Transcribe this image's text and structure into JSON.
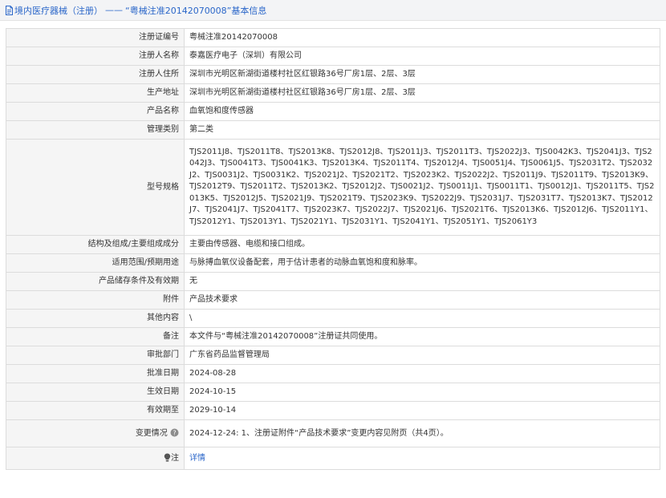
{
  "header": {
    "crumb": "境内医疗器械（注册）",
    "separator": "——",
    "record_title": "“粤械注准20142070008”基本信息"
  },
  "rows": [
    {
      "label": "注册证编号",
      "value": "粤械注准20142070008"
    },
    {
      "label": "注册人名称",
      "value": "泰嘉医疗电子（深圳）有限公司"
    },
    {
      "label": "注册人住所",
      "value": "深圳市光明区新湖街道楼村社区红银路36号厂房1层、2层、3层"
    },
    {
      "label": "生产地址",
      "value": "深圳市光明区新湖街道楼村社区红银路36号厂房1层、2层、3层"
    },
    {
      "label": "产品名称",
      "value": "血氧饱和度传感器"
    },
    {
      "label": "管理类别",
      "value": "第二类"
    },
    {
      "label": "型号规格",
      "value": "TJS2011J8、TJS2011T8、TJS2013K8、TJS2012J8、TJS2011J3、TJS2011T3、TJS2022J3、TJS0042K3、TJS2041J3、TJS2042J3、TJS0041T3、TJS0041K3、TJS2013K4、TJS2011T4、TJS2012J4、TJS0051J4、TJS0061J5、TJS2031T2、TJS2032J2、TJS0031J2、TJS0031K2、TJS2021J2、TJS2021T2、TJS2023K2、TJS2022J2、TJS2011J9、TJS2011T9、TJS2013K9、TJS2012T9、TJS2011T2、TJS2013K2、TJS2012J2、TJS0021J2、TJS0011J1、TJS0011T1、TJS0012J1、TJS2011T5、TJS2013K5、TJS2012J5、TJS2021J9、TJS2021T9、TJS2023K9、TJS2022J9、TJS2031J7、TJS2031T7、TJS2013K7、TJS2012J7、TJS2041J7、TJS2041T7、TJS2023K7、TJS2022J7、TJS2021J6、TJS2021T6、TJS2013K6、TJS2012J6、TJS2011Y1、TJS2012Y1、TJS2013Y1、TJS2021Y1、TJS2031Y1、TJS2041Y1、TJS2051Y1、TJS2061Y3"
    },
    {
      "label": "结构及组成/主要组成成分",
      "value": "主要由传感器、电缆和接口组成。"
    },
    {
      "label": "适用范围/预期用途",
      "value": "与脉搏血氧仪设备配套，用于估计患者的动脉血氧饱和度和脉率。"
    },
    {
      "label": "产品储存条件及有效期",
      "value": "无"
    },
    {
      "label": "附件",
      "value": "产品技术要求"
    },
    {
      "label": "其他内容",
      "value": "\\"
    },
    {
      "label": "备注",
      "value": "本文件与“粤械注准20142070008”注册证共同使用。"
    },
    {
      "label": "审批部门",
      "value": "广东省药品监督管理局"
    },
    {
      "label": "批准日期",
      "value": "2024-08-28"
    },
    {
      "label": "生效日期",
      "value": "2024-10-15"
    },
    {
      "label": "有效期至",
      "value": "2029-10-14"
    },
    {
      "label": "变更情况",
      "value": "2024-12-24: 1、注册证附件“产品技术要求”变更内容见附页（共4页）。"
    }
  ],
  "note_row": {
    "label": "注",
    "link": "详情"
  },
  "icons": {
    "title": "document-icon",
    "changes": "help-circle-icon",
    "note": "lightbulb-icon"
  },
  "colors": {
    "link": "#2a66c9",
    "label_bg": "#f5f5f5",
    "border": "#dcdcdc",
    "header_bg": "#f3f4f6"
  }
}
